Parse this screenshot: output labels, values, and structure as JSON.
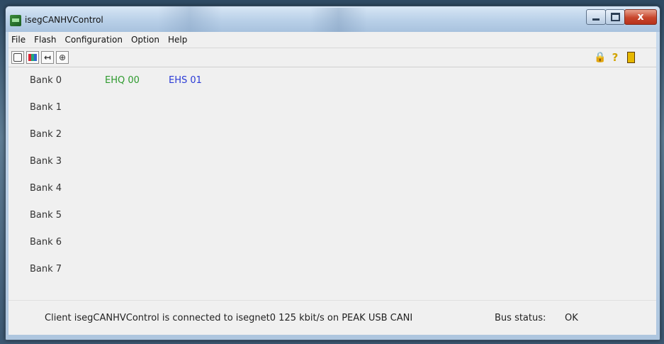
{
  "window": {
    "title": "isegCANHVControl",
    "close_symbol": "x"
  },
  "menu": [
    "File",
    "Flash",
    "Configuration",
    "Option",
    "Help"
  ],
  "toolbar": {
    "left_icons": [
      "connect-icon",
      "scan-icon",
      "back-arrows-icon",
      "settings-icon"
    ],
    "right_icons": [
      "lock-icon",
      "help-icon",
      "exit-icon"
    ],
    "back_glyph": "↤",
    "settings_glyph": "⊕",
    "lock_glyph": "🔒",
    "help_glyph": "?"
  },
  "banks": [
    {
      "label": "Bank 0",
      "modules": [
        {
          "name": "EHQ 00",
          "color": "#2e9a2e"
        },
        {
          "name": "EHS 01",
          "color": "#2a3ad6"
        }
      ]
    },
    {
      "label": "Bank 1",
      "modules": []
    },
    {
      "label": "Bank 2",
      "modules": []
    },
    {
      "label": "Bank 3",
      "modules": []
    },
    {
      "label": "Bank 4",
      "modules": []
    },
    {
      "label": "Bank 5",
      "modules": []
    },
    {
      "label": "Bank 6",
      "modules": []
    },
    {
      "label": "Bank 7",
      "modules": []
    }
  ],
  "status": {
    "message": "Client isegCANHVControl is connected to isegnet0 125 kbit/s on PEAK USB CANI",
    "bus_label": "Bus status:",
    "bus_value": "OK"
  }
}
